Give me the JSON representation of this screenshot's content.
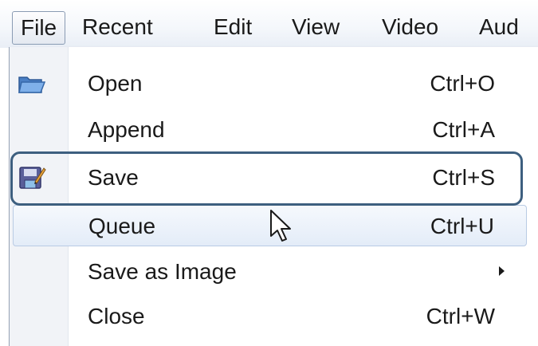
{
  "menubar": {
    "items": [
      {
        "label": "File"
      },
      {
        "label": "Recent"
      },
      {
        "label": "Edit"
      },
      {
        "label": "View"
      },
      {
        "label": "Video"
      },
      {
        "label": "Aud"
      }
    ]
  },
  "file_menu": {
    "items": [
      {
        "label": "Open",
        "shortcut": "Ctrl+O",
        "icon": "folder-open-icon"
      },
      {
        "label": "Append",
        "shortcut": "Ctrl+A"
      },
      {
        "label": "Save",
        "shortcut": "Ctrl+S",
        "icon": "save-disk-icon"
      },
      {
        "label": "Queue",
        "shortcut": "Ctrl+U"
      },
      {
        "label": "Save as Image",
        "shortcut": "",
        "has_submenu": true
      },
      {
        "label": "Close",
        "shortcut": "Ctrl+W"
      }
    ]
  },
  "colors": {
    "highlight_outline": "#3d5f7f",
    "hover_fill": "#e3ecf8"
  }
}
